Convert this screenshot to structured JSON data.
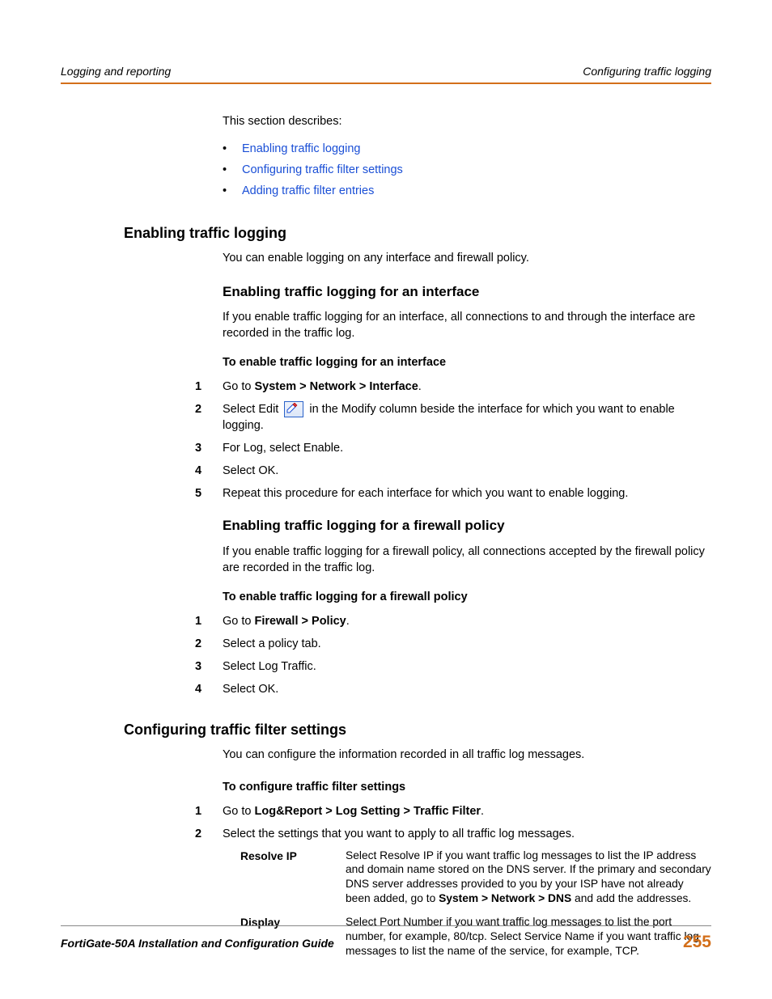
{
  "header": {
    "left": "Logging and reporting",
    "right": "Configuring traffic logging"
  },
  "intro": "This section describes:",
  "bullets": [
    "Enabling traffic logging",
    "Configuring traffic filter settings",
    "Adding traffic filter entries"
  ],
  "s1": {
    "title": "Enabling traffic logging",
    "para": "You can enable logging on any interface and firewall policy.",
    "sub1": {
      "title": "Enabling traffic logging for an interface",
      "para": "If you enable traffic logging for an interface, all connections to and through the interface are recorded in the traffic log.",
      "proc": "To enable traffic logging for an interface",
      "steps": {
        "s1a": "Go to ",
        "s1b": "System > Network > Interface",
        "s1c": ".",
        "s2a": "Select Edit ",
        "s2b": " in the Modify column beside the interface for which you want to enable logging.",
        "s3": "For Log, select Enable.",
        "s4": "Select OK.",
        "s5": "Repeat this procedure for each interface for which you want to enable logging."
      }
    },
    "sub2": {
      "title": "Enabling traffic logging for a firewall policy",
      "para": "If you enable traffic logging for a firewall policy, all connections accepted by the firewall policy are recorded in the traffic log.",
      "proc": "To enable traffic logging for a firewall policy",
      "steps": {
        "s1a": "Go to ",
        "s1b": "Firewall > Policy",
        "s1c": ".",
        "s2": "Select a policy tab.",
        "s3": "Select Log Traffic.",
        "s4": "Select OK."
      }
    }
  },
  "s2": {
    "title": "Configuring traffic filter settings",
    "para": "You can configure the information recorded in all traffic log messages.",
    "proc": "To configure traffic filter settings",
    "steps": {
      "s1a": "Go to ",
      "s1b": "Log&Report > Log Setting > Traffic Filter",
      "s1c": ".",
      "s2": "Select the settings that you want to apply to all traffic log messages."
    },
    "table": {
      "r1": {
        "label": "Resolve IP",
        "d1": "Select Resolve IP if you want traffic log messages to list the IP address and domain name stored on the DNS server. If the primary and secondary DNS server addresses provided to you by your ISP have not already been added, go to ",
        "d2": "System > Network > DNS",
        "d3": " and add the addresses."
      },
      "r2": {
        "label": "Display",
        "desc": "Select Port Number if you want traffic log messages to list the port number, for example, 80/tcp. Select Service Name if you want traffic log messages to list the name of the service, for example, TCP."
      }
    }
  },
  "footer": {
    "left": "FortiGate-50A Installation and Configuration Guide",
    "page": "255"
  }
}
